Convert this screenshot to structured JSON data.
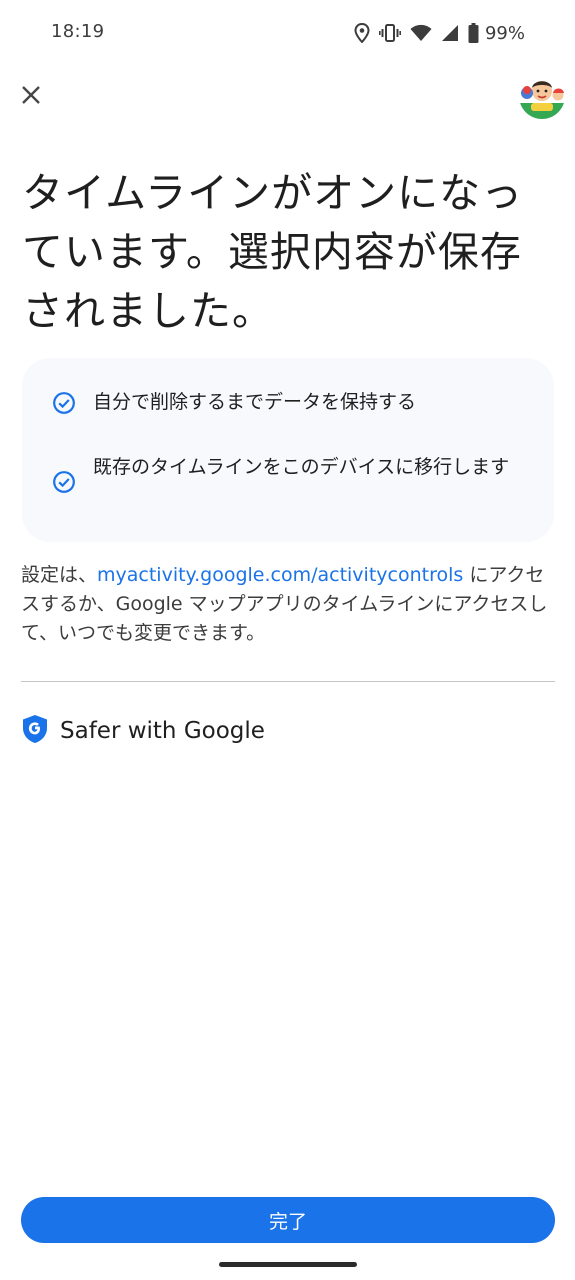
{
  "status_bar": {
    "time": "18:19",
    "battery": "99%",
    "icons": [
      "location-icon",
      "vibrate-icon",
      "wifi-icon",
      "cellular-signal-icon",
      "battery-icon"
    ]
  },
  "header": {
    "close_icon": "close-icon",
    "avatar": "account-avatar"
  },
  "title": "タイムラインがオンになっています。選択内容が保存されました。",
  "card": {
    "items": [
      {
        "icon": "check-circle-icon",
        "label": "自分で削除するまでデータを保持する"
      },
      {
        "icon": "check-circle-icon",
        "label": "既存のタイムラインをこのデバイスに移行します"
      }
    ]
  },
  "info": {
    "prefix": "設定は、",
    "link": "myactivity.google.com/activitycontrols",
    "suffix": " にアクセスするか、Google マップアプリのタイムラインにアクセスして、いつでも変更できます。"
  },
  "safer": {
    "icon": "google-shield-icon",
    "label": "Safer with Google"
  },
  "done_button": "完了",
  "colors": {
    "accent": "#1a73e8",
    "card_bg": "#f7f9fd",
    "text": "#1f1f1f"
  }
}
